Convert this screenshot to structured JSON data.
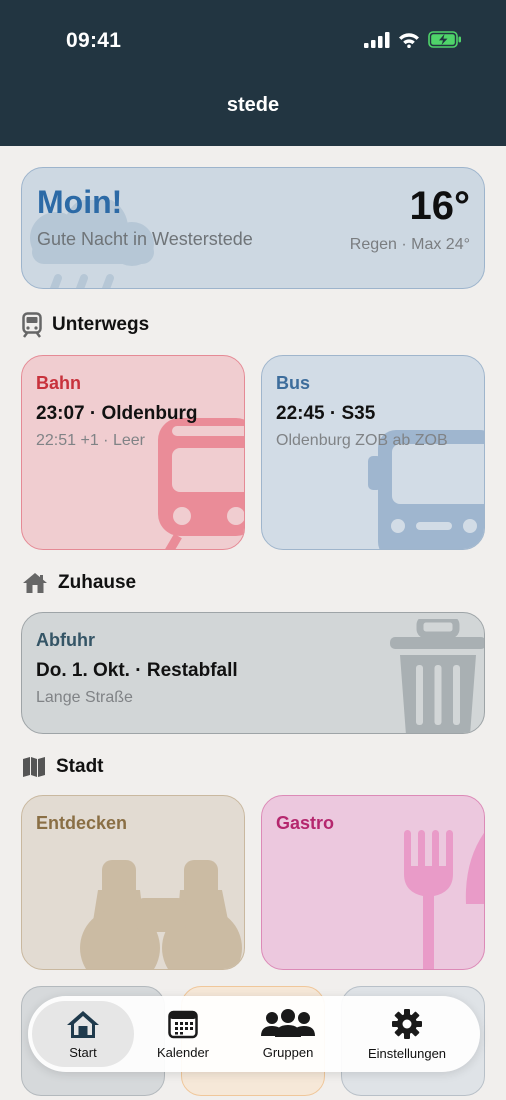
{
  "status_bar": {
    "time": "09:41",
    "icons": [
      "signal-icon",
      "wifi-icon",
      "battery-charging-icon"
    ]
  },
  "app": {
    "title": "stede"
  },
  "weather": {
    "greeting": "Moin!",
    "subtitle": "Gute Nacht in Westerstede",
    "temperature": "16°",
    "condition": "Regen · Max 24°",
    "icon": "rain-cloud-icon"
  },
  "sections": {
    "unterwegs": {
      "label": "Unterwegs",
      "icon": "train-icon"
    },
    "zuhause": {
      "label": "Zuhause",
      "icon": "house-icon"
    },
    "stadt": {
      "label": "Stadt",
      "icon": "map-icon"
    }
  },
  "transit": {
    "bahn": {
      "label": "Bahn",
      "main": "23:07 · Oldenburg",
      "sub": "22:51 +1 · Leer",
      "icon": "tram-icon",
      "color": "#c8323c"
    },
    "bus": {
      "label": "Bus",
      "main": "22:45 · S35",
      "sub": "Oldenburg ZOB ab ZOB",
      "icon": "bus-icon",
      "color": "#3d6d9c"
    }
  },
  "abfuhr": {
    "label": "Abfuhr",
    "main": "Do. 1. Okt. · Restabfall",
    "sub": "Lange Straße",
    "icon": "trash-can-icon",
    "color": "#355566"
  },
  "city": {
    "entdecken": {
      "label": "Entdecken",
      "icon": "binoculars-icon",
      "color": "#8a6f45"
    },
    "gastro": {
      "label": "Gastro",
      "icon": "fork-knife-icon",
      "color": "#b5276e"
    }
  },
  "tabbar": {
    "items": [
      {
        "label": "Start",
        "icon": "home-icon",
        "active": true
      },
      {
        "label": "Kalender",
        "icon": "calendar-icon",
        "active": false
      },
      {
        "label": "Gruppen",
        "icon": "people-icon",
        "active": false
      },
      {
        "label": "Einstellungen",
        "icon": "gear-icon",
        "active": false
      }
    ]
  }
}
